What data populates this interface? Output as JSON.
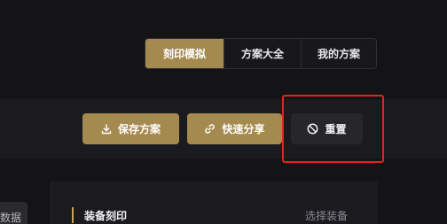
{
  "tabs": [
    {
      "label": "刻印模拟",
      "active": true
    },
    {
      "label": "方案大全",
      "active": false
    },
    {
      "label": "我的方案",
      "active": false
    }
  ],
  "toolbar": {
    "save_label": "保存方案",
    "share_label": "快速分享",
    "reset_label": "重置",
    "save_icon": "download-icon",
    "share_icon": "link-icon",
    "reset_icon": "ban-icon"
  },
  "left_panel": {
    "chip_text": "数据"
  },
  "equipment": {
    "section_title": "装备刻印",
    "select_label": "选择装备"
  },
  "colors": {
    "accent": "#a58a4f",
    "background": "#141417",
    "highlight": "#e02323"
  }
}
